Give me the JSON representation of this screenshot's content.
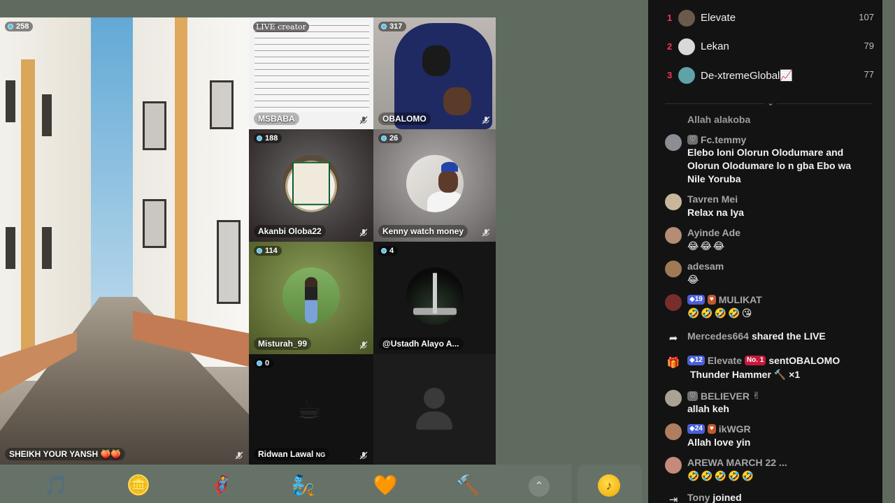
{
  "grid": {
    "main": {
      "count": "258",
      "name": "SHEIKH YOUR YANSH 🍑🍑"
    },
    "doc": {
      "live_tag": "LIVE creator",
      "name": "MSBABA"
    },
    "obalomo": {
      "count": "317",
      "name": "OBALOMO"
    },
    "akanbi": {
      "count": "188",
      "name": "Akanbi Oloba22"
    },
    "kenny": {
      "count": "26",
      "name": "Kenny watch money"
    },
    "misturah": {
      "count": "114",
      "name": "Misturah_99"
    },
    "ustadh": {
      "count": "4",
      "name": "@Ustadh Alayo A..."
    },
    "ridwan": {
      "count": "0",
      "name": "Ridwan Lawal",
      "tag": "NG"
    }
  },
  "gifts": [
    {
      "icon": "music-note-gift-icon",
      "glyph": "🎵"
    },
    {
      "icon": "coin-gift-icon",
      "glyph": "🪙"
    },
    {
      "icon": "hero-gift-icon",
      "glyph": "🦸"
    },
    {
      "icon": "genie-gift-icon",
      "glyph": "🧞"
    },
    {
      "icon": "heart-gift-icon",
      "glyph": "🧡"
    },
    {
      "icon": "hammer-gift-icon",
      "glyph": "🔨"
    }
  ],
  "gift_more": "⌃",
  "coin_glyph": "♪",
  "leaderboard": [
    {
      "rank": "1",
      "name": "Elevate",
      "score": "107",
      "color": "#6b5a4a"
    },
    {
      "rank": "2",
      "name": "Lekan",
      "score": "79",
      "color": "#d9d9d9"
    },
    {
      "rank": "3",
      "name": "De-xtremeGlobal📈",
      "score": "77",
      "color": "#5fa3a8"
    }
  ],
  "chat": {
    "partial": {
      "text": "Allah alakoba"
    },
    "m1": {
      "user": "Fc.temmy",
      "text": "Elebo loni Olorun Olodumare and Olorun Olodumare lo n gba Ebo wa Nile Yoruba"
    },
    "m2": {
      "user": "Tavren Mei",
      "text": "Relax na Iya"
    },
    "m3": {
      "user": "Ayinde Ade",
      "text": "😂😂😂"
    },
    "m4": {
      "user": "adesam",
      "text": "😂"
    },
    "m5": {
      "badge": "19",
      "user": "MULIKAT",
      "text": "🤣🤣🤣🤣😘"
    },
    "share": {
      "user": "Mercedes664",
      "action": "shared the LIVE"
    },
    "gift": {
      "badge": "12",
      "user": "Elevate",
      "rank_badge": "No. 1",
      "action": "sentOBALOMO",
      "item": "Thunder Hammer",
      "mult": "×1"
    },
    "m6": {
      "user": "BELIEVER",
      "text": "allah keh"
    },
    "m7": {
      "badge": "24",
      "user": "ikWGR",
      "text": "Allah love yin"
    },
    "m8": {
      "user": "AREWA MARCH 22 ...",
      "text": "🤣🤣🤣🤣🤣"
    },
    "join": {
      "user": "Tony",
      "action": "joined"
    }
  }
}
